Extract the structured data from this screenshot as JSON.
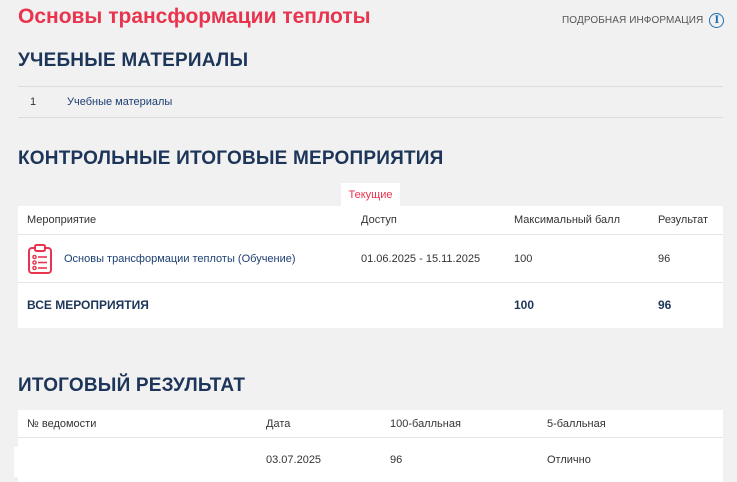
{
  "header": {
    "title": "Основы трансформации теплоты",
    "info_link": "ПОДРОБНАЯ ИНФОРМАЦИЯ",
    "info_icon": "info-icon"
  },
  "materials": {
    "heading": "УЧЕБНЫЕ МАТЕРИАЛЫ",
    "items": [
      {
        "num": "1",
        "label": "Учебные материалы"
      }
    ]
  },
  "control": {
    "heading": "КОНТРОЛЬНЫЕ ИТОГОВЫЕ МЕРОПРИЯТИЯ",
    "tab_label": "Текущие",
    "columns": [
      "Мероприятие",
      "Доступ",
      "Максимальный балл",
      "Результат"
    ],
    "rows": [
      {
        "icon": "clipboard-list-icon",
        "name": "Основы трансформации теплоты (Обучение)",
        "access": "01.06.2025 - 15.11.2025",
        "max": "100",
        "result": "96"
      }
    ],
    "total": {
      "label": "ВСЕ МЕРОПРИЯТИЯ",
      "max": "100",
      "result": "96"
    }
  },
  "final": {
    "heading": "ИТОГОВЫЙ РЕЗУЛЬТАТ",
    "columns": [
      "№ ведомости",
      "Дата",
      "100-балльная",
      "5-балльная"
    ],
    "rows": [
      {
        "sheet": "",
        "date": "03.07.2025",
        "score100": "96",
        "score5": "Отлично"
      }
    ]
  },
  "colors": {
    "accent": "#e8344e",
    "heading": "#1d3559",
    "link": "#1d3f73"
  }
}
